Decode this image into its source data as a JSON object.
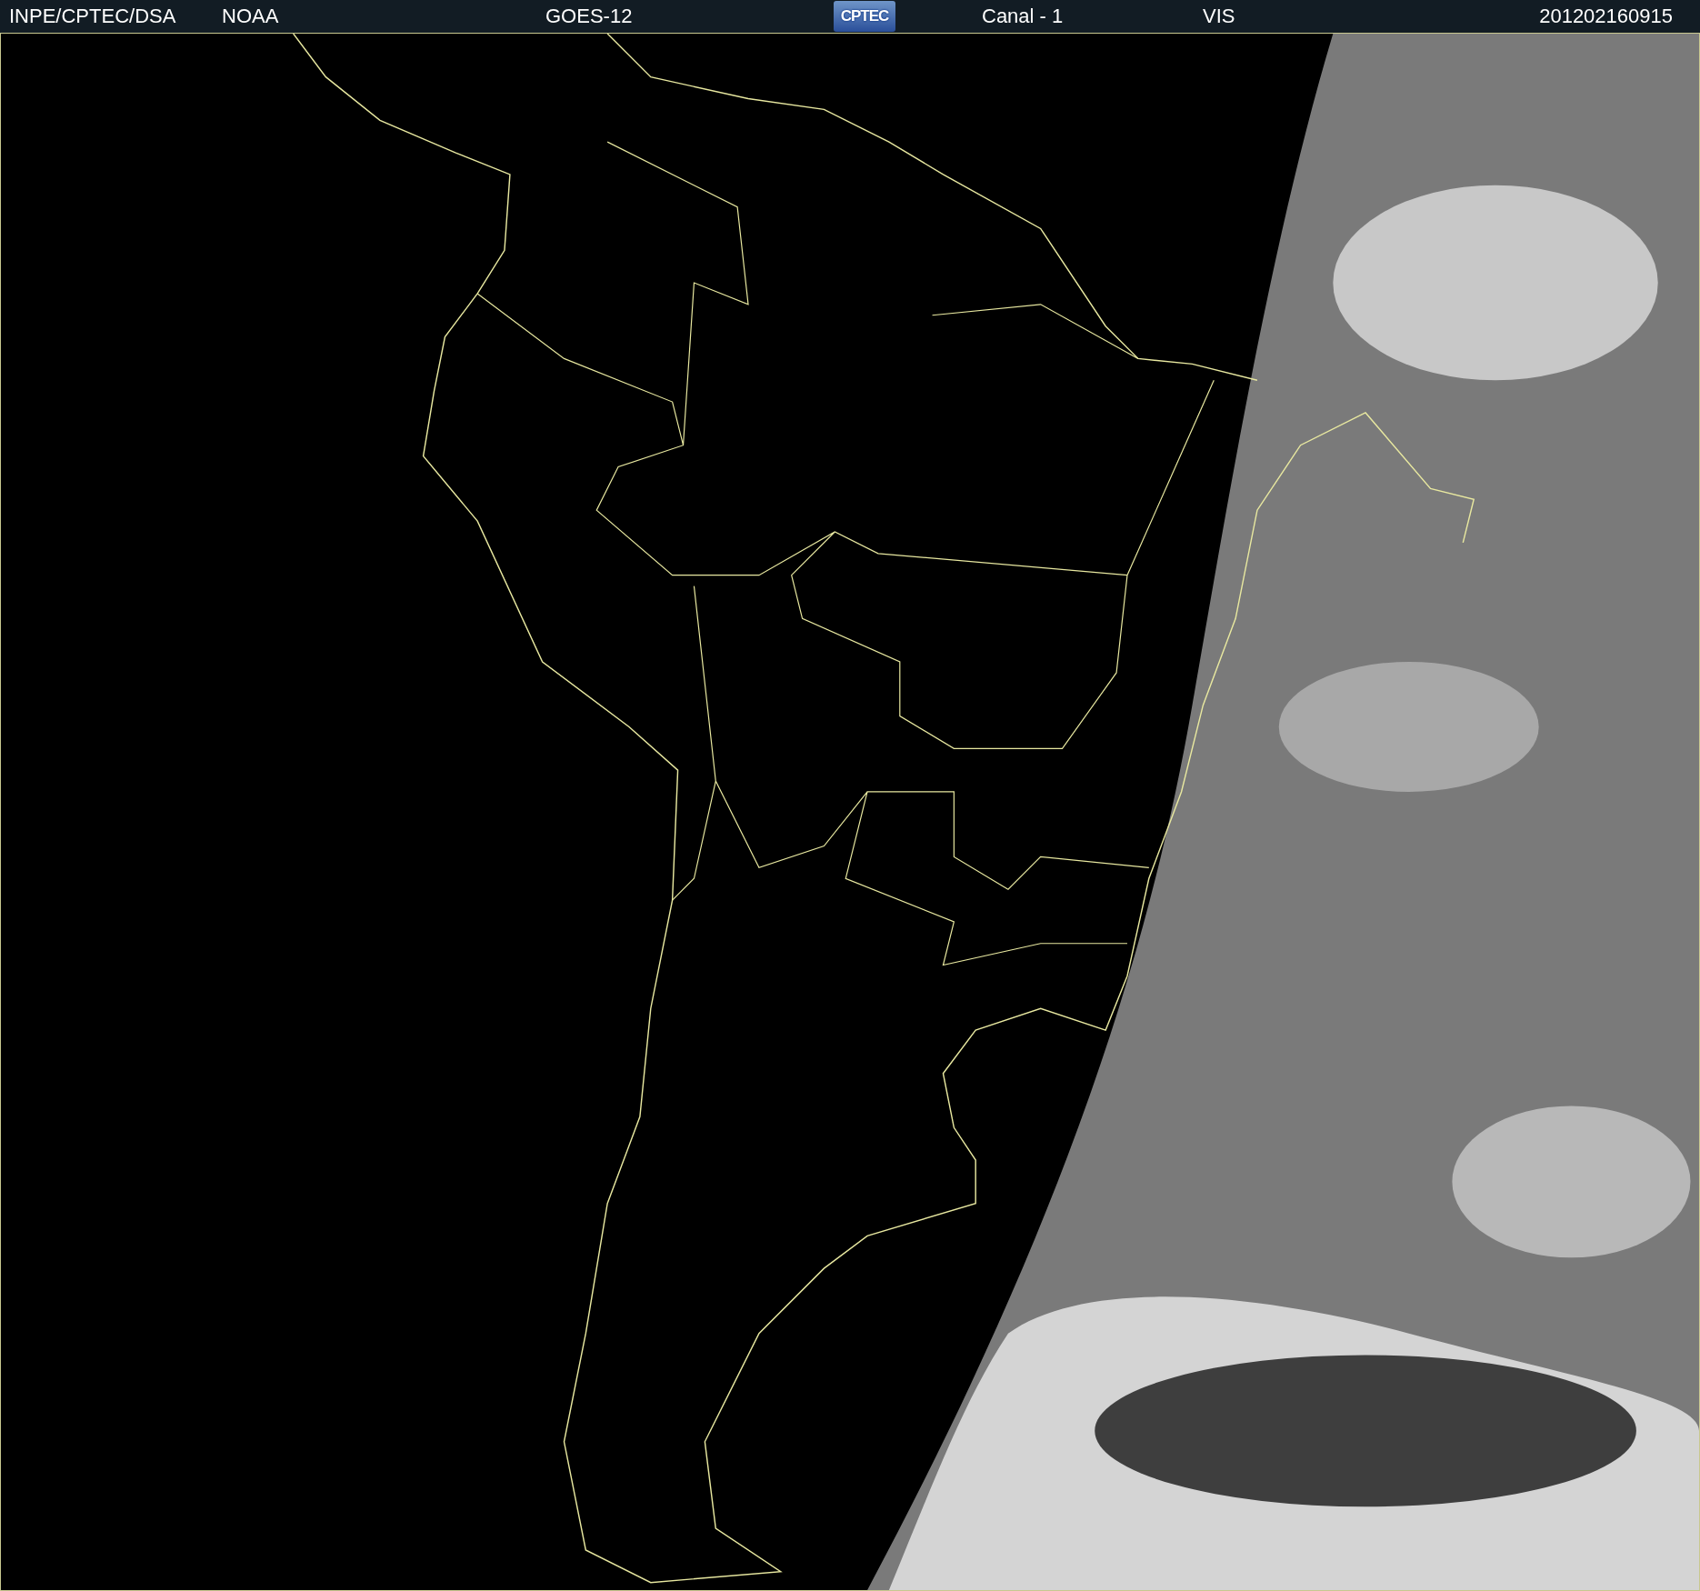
{
  "header": {
    "items": [
      {
        "kind": "text",
        "text": "INPE/CPTEC/DSA"
      },
      {
        "kind": "text",
        "text": "NOAA"
      },
      {
        "kind": "text",
        "text": "GOES-12"
      },
      {
        "kind": "logo",
        "text": "CPTEC"
      },
      {
        "kind": "text",
        "text": "Canal - 1"
      },
      {
        "kind": "text",
        "text": "VIS"
      },
      {
        "kind": "text",
        "text": "201202160915"
      }
    ]
  }
}
